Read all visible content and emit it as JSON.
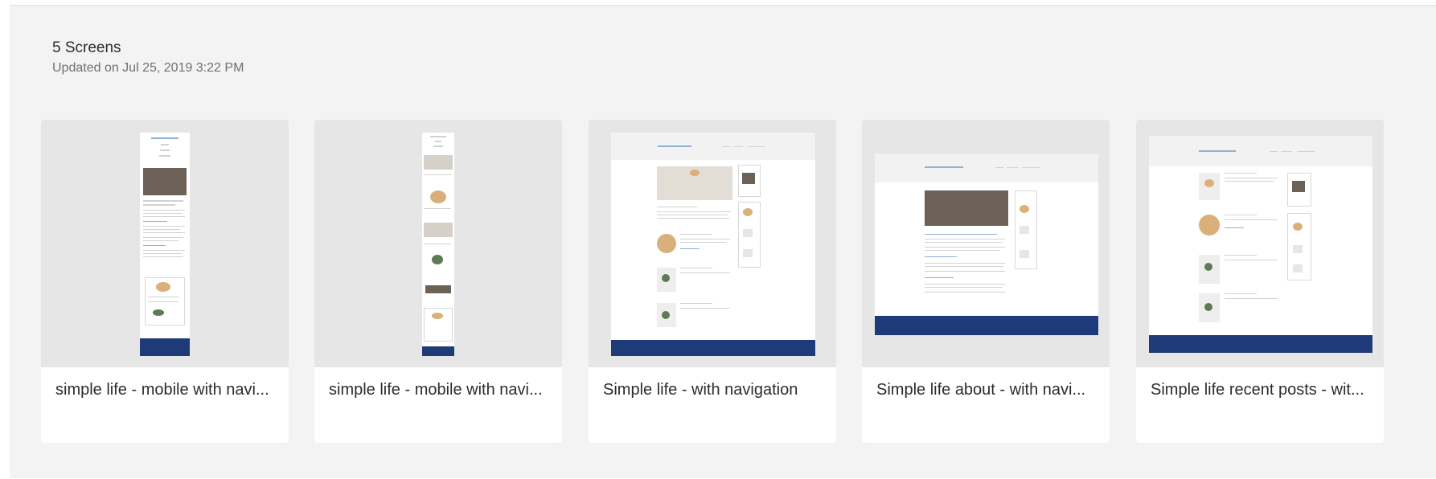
{
  "project": {
    "screen_count": "5 Screens",
    "updated": "Updated on Jul 25, 2019 3:22 PM"
  },
  "screens": [
    {
      "title": "simple life - mobile with navi..."
    },
    {
      "title": "simple life - mobile with navi..."
    },
    {
      "title": "Simple life - with navigation"
    },
    {
      "title": "Simple life about - with navi..."
    },
    {
      "title": "Simple life recent posts - wit..."
    }
  ],
  "colors": {
    "panel_bg": "#f3f3f3",
    "thumb_bg": "#e6e6e6",
    "footer_navy": "#1f3a78",
    "link_blue": "#8fb0d6"
  }
}
